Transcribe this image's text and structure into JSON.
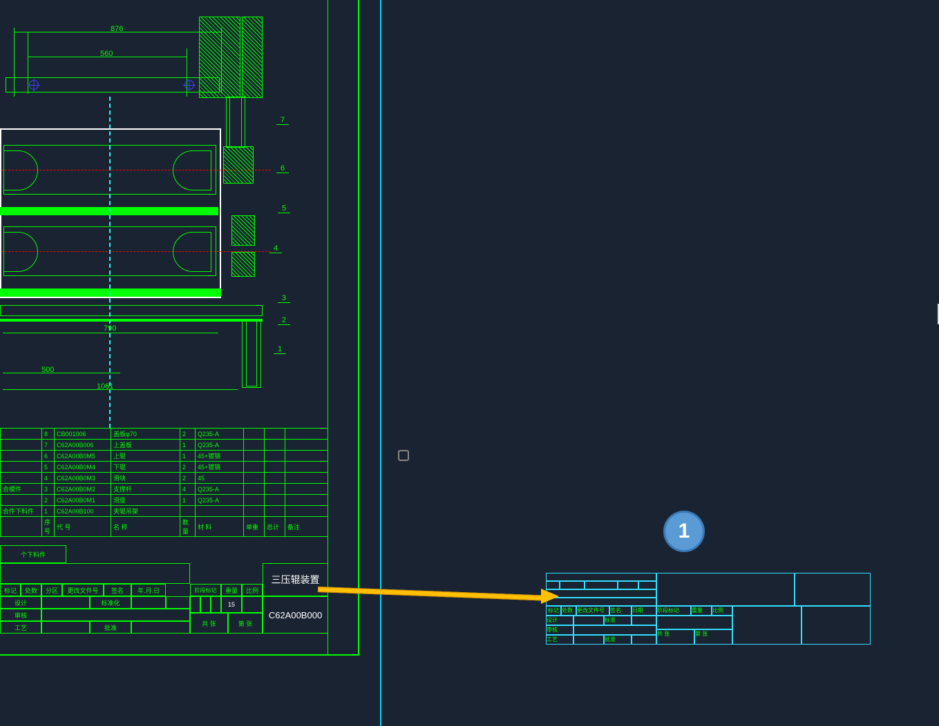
{
  "dimensions": {
    "top1": "876",
    "top2": "560",
    "mid": "790",
    "low1": "500",
    "low2": "1061"
  },
  "leaders": [
    "1",
    "2",
    "3",
    "4",
    "5",
    "6",
    "7"
  ],
  "parts": [
    {
      "no": "8",
      "code": "CB001006",
      "name": "盖板φ70",
      "qty": "2",
      "mat": "Q235-A"
    },
    {
      "no": "7",
      "code": "C62A00B006",
      "name": "上盖板",
      "qty": "1",
      "mat": "Q235-A"
    },
    {
      "no": "6",
      "code": "C62A00B0M5",
      "name": "上辊",
      "qty": "1",
      "mat": "45+镀铬"
    },
    {
      "no": "5",
      "code": "C62A00B0M4",
      "name": "下辊",
      "qty": "2",
      "mat": "45+镀铬"
    },
    {
      "no": "4",
      "code": "C62A00B0M3",
      "name": "滑块",
      "qty": "2",
      "mat": "45"
    },
    {
      "no": "3",
      "code": "C62A00B0M2",
      "name": "支撑杆",
      "qty": "4",
      "mat": "Q235-A"
    },
    {
      "no": "2",
      "code": "C62A00B0M1",
      "name": "滑座",
      "qty": "1",
      "mat": "Q235-A"
    },
    {
      "no": "1",
      "code": "C62A00B100",
      "name": "夹辊吊架",
      "qty": "",
      "mat": ""
    }
  ],
  "parts_headers": {
    "col0a": "合模件",
    "col0b": "合件下料件",
    "c1": "序号",
    "c2": "代    号",
    "c3": "名    称",
    "c4": "数量",
    "c5": "材    料",
    "c6": "单重",
    "c7": "总计",
    "c8": "备注"
  },
  "title_block": {
    "row_labels": [
      "标记",
      "处数",
      "分区",
      "更改文件号",
      "签名",
      "年.月.日"
    ],
    "row2": [
      "设计",
      "",
      "标准化",
      ""
    ],
    "row3": [
      "审核",
      ""
    ],
    "row4": [
      "工艺",
      "",
      "批准",
      ""
    ],
    "mid1": "阶段标记",
    "mid2": "重量",
    "mid3": "比例",
    "val": "15",
    "bot1": "共  张",
    "bot2": "第  张",
    "main_title": "三压辊装置",
    "drawing_no": "C62A00B000",
    "sub": "个下料件"
  },
  "right_block_labels": {
    "r1c1": "标记",
    "r1c2": "处数",
    "r1c3": "更改文件号",
    "r1c4": "签名",
    "r1c5": "日期",
    "r2c1": "设计",
    "r2c2": "",
    "r2c3": "标准",
    "r2c4": "",
    "r3c1": "审核",
    "r3c2": "",
    "r4c1": "工艺",
    "r4c2": "",
    "r4c3": "批准",
    "m1": "阶段标记",
    "m2": "重量",
    "m3": "比例",
    "b1": "共  张",
    "b2": "第  张"
  },
  "annotation": {
    "badge": "1"
  }
}
